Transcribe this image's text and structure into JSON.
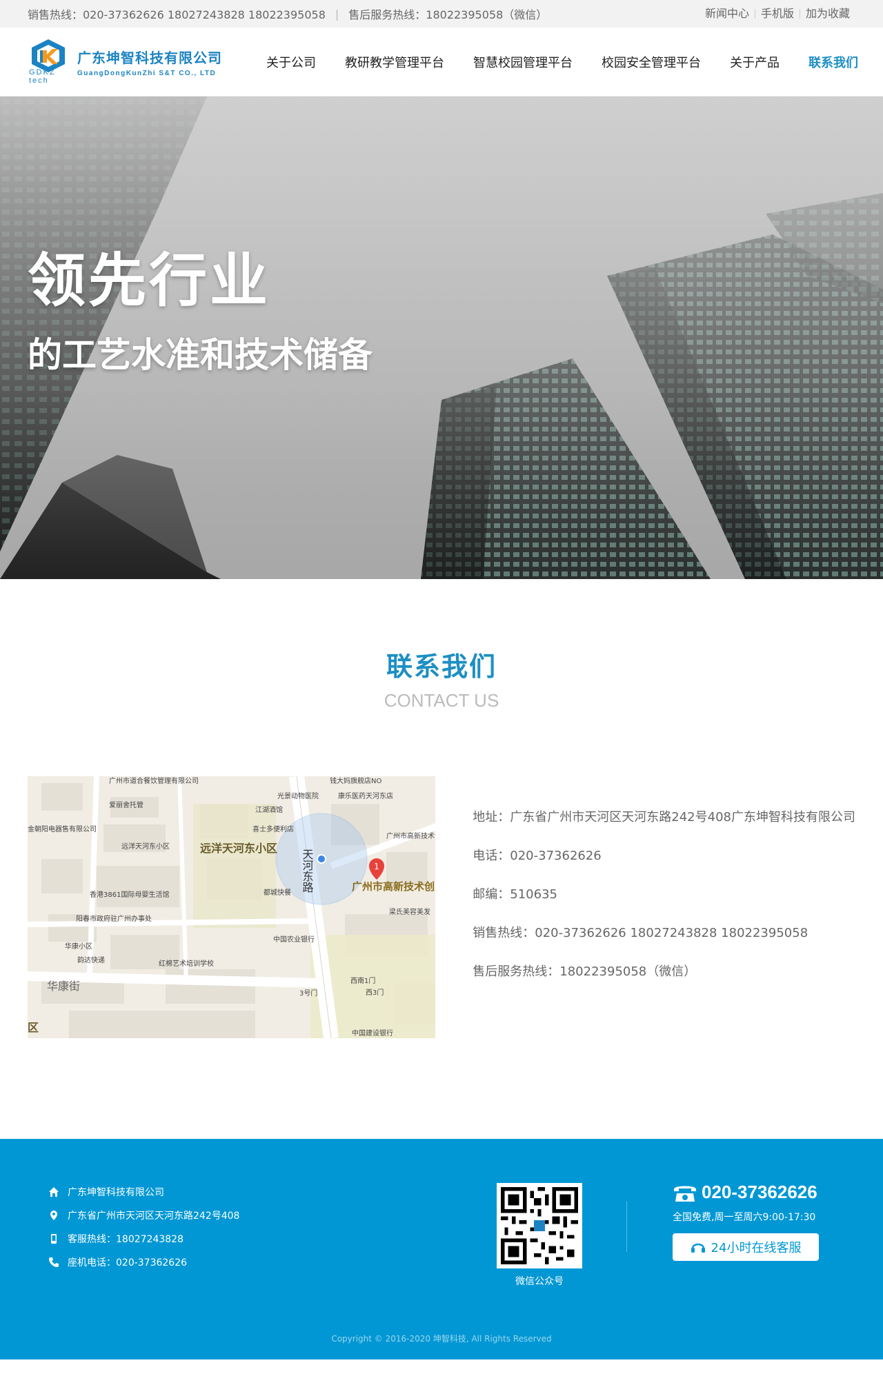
{
  "topbar": {
    "sales_hotline": "销售热线：020-37362626   18027243828  18022395058",
    "after_sales": "售后服务热线：18022395058（微信）",
    "links": [
      "新闻中心",
      "手机版",
      "加为收藏"
    ]
  },
  "header": {
    "logo_cn": "广东坤智科技有限公司",
    "logo_en": "GuangDongKunZhi S&T CO., LTD",
    "logo_abbr": "GDKZ tech",
    "nav": [
      "关于公司",
      "教研教学管理平台",
      "智慧校园管理平台",
      "校园安全管理平台",
      "关于产品",
      "联系我们"
    ]
  },
  "banner": {
    "headline": "领先行业",
    "subline": "的工艺水准和技术储备"
  },
  "section": {
    "title_cn": "联系我们",
    "title_en": "CONTACT US"
  },
  "map": {
    "labels": [
      "广州市道合餐饮管理有限公司",
      "钱大妈旗舰店NO",
      "光景动物医院",
      "康乐医药天河东店",
      "爱丽舍托管",
      "江湖酒馆",
      "喜士多便利店",
      "广州市高新技术创业服务中心",
      "金朝阳电器售有限公司",
      "远洋天河东小区",
      "远洋天河东小区",
      "天河东路",
      "广州市高新技术创业服务中心",
      "都城快餐",
      "香港3861国际母婴生活馆",
      "梁氏美容美发",
      "阳春市政府驻广州办事处",
      "中国农业银行",
      "华康小区",
      "韵达快递",
      "红棉艺术培训学校",
      "华康街",
      "西南1门",
      "3号门",
      "西3门",
      "中国建设银行",
      "区"
    ],
    "pin_number": "1"
  },
  "contact": {
    "address": "地址：广东省广州市天河区天河东路242号408广东坤智科技有限公司",
    "phone": "电话：020-37362626",
    "postcode": "邮编：510635",
    "sales": "销售热线：020-37362626   18027243828  18022395058",
    "after_sales": "售后服务热线：18022395058（微信）"
  },
  "footer": {
    "company": "广东坤智科技有限公司",
    "address": "广东省广州市天河区天河东路242号408",
    "service_hotline": "客服热线：18027243828",
    "landline": "座机电话：020-37362626",
    "qr_label": "微信公众号",
    "phone": "020-37362626",
    "hours": "全国免费,周一至周六9:00-17:30",
    "online_service": "24小时在线客服",
    "copyright": "Copyright © 2016-2020 坤智科技, All Rights Reserved"
  },
  "colors": {
    "brand_blue": "#1c8fc4",
    "footer_blue": "#0097d4"
  }
}
